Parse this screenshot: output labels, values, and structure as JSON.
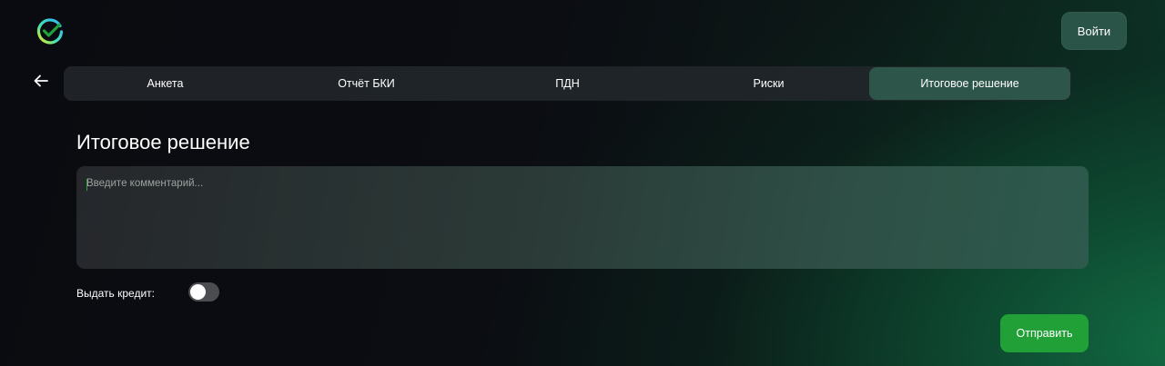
{
  "header": {
    "logo_icon": "sber-logo-icon",
    "login_label": "Войти"
  },
  "nav": {
    "back_icon": "arrow-left-icon",
    "tabs": [
      {
        "label": "Анкета",
        "active": false
      },
      {
        "label": "Отчёт БКИ",
        "active": false
      },
      {
        "label": "ПДН",
        "active": false
      },
      {
        "label": "Риски",
        "active": false
      },
      {
        "label": "Итоговое решение",
        "active": true
      }
    ]
  },
  "main": {
    "title": "Итоговое решение",
    "comment": {
      "value": "",
      "placeholder": "Введите комментарий..."
    },
    "credit_toggle": {
      "label": "Выдать кредит:",
      "checked": false
    },
    "submit_label": "Отправить"
  },
  "colors": {
    "accent_green": "#21a038",
    "active_tab": "#2d5549",
    "login_button": "#2a5448"
  }
}
